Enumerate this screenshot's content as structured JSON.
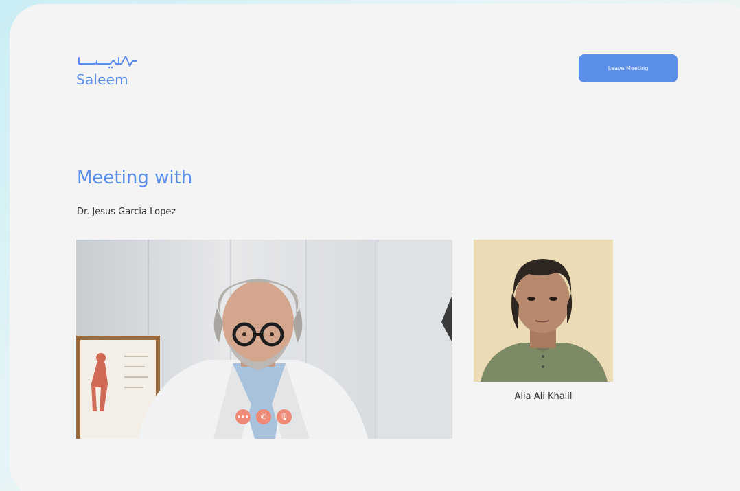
{
  "brand": {
    "name": "Saleem",
    "color": "#5b8ee8"
  },
  "header": {
    "leave_label": "Leave Meeting"
  },
  "meeting": {
    "title": "Meeting with",
    "doctor_name": "Dr. Jesus Garcia Lopez",
    "patient_name": "Alia Ali Khalil"
  },
  "controls": [
    {
      "name": "more-icon",
      "glyph": "•••"
    },
    {
      "name": "phone-icon",
      "glyph": "✆"
    },
    {
      "name": "microphone-icon",
      "glyph": "🎙"
    }
  ],
  "colors": {
    "accent": "#5b8ee8",
    "control": "#f08a78",
    "card": "#f4f4f4"
  }
}
